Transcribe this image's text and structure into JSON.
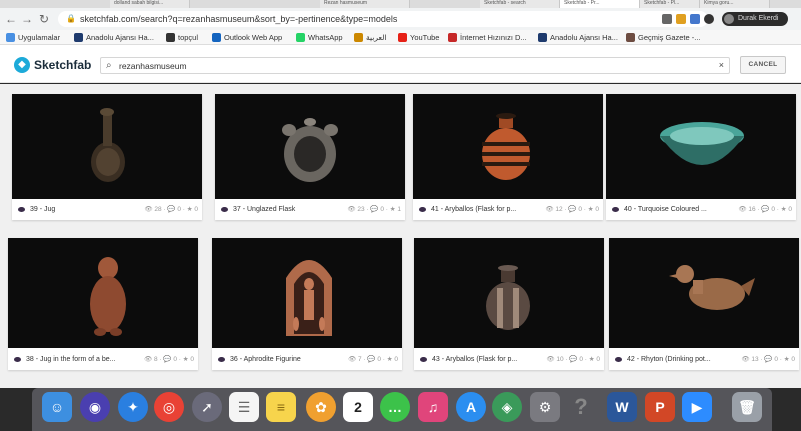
{
  "browser": {
    "tabs": [
      {
        "label": "dolland sabah bilgisi..."
      },
      {
        "label": "Rezan hasmuseum"
      },
      {
        "label": "Sketchfab - search"
      },
      {
        "label": "Sketchfab - Pr..."
      },
      {
        "label": "Sketchfab - Pl..."
      },
      {
        "label": "Kimya goru..."
      }
    ],
    "url": "sketchfab.com/search?q=rezanhasmuseum&sort_by=-pertinence&type=models",
    "profile_name": "Durak Ekerdi"
  },
  "bookmarks": [
    {
      "label": "Uygulamalar",
      "color": "#4a90e2"
    },
    {
      "label": "Anadolu Ajansı Ha...",
      "color": "#1f3b6e"
    },
    {
      "label": "topçul",
      "color": "#333333"
    },
    {
      "label": "Outlook Web App",
      "color": "#1565c0"
    },
    {
      "label": "WhatsApp",
      "color": "#25d366"
    },
    {
      "label": "العربية",
      "color": "#cc8800"
    },
    {
      "label": "YouTube",
      "color": "#e62117"
    },
    {
      "label": "İnternet Hızınızı D...",
      "color": "#c62828"
    },
    {
      "label": "Anadolu Ajansı Ha...",
      "color": "#1f3b6e"
    },
    {
      "label": "Geçmiş Gazete -...",
      "color": "#6d4c41"
    }
  ],
  "site": {
    "logo": "Sketchfab",
    "search_value": "rezanhasmuseum",
    "clear_symbol": "×",
    "cancel_label": "CANCEL"
  },
  "models": [
    {
      "title": "39 - Jug",
      "views": "28",
      "comments": "0",
      "likes": "0"
    },
    {
      "title": "37 - Unglazed Flask",
      "views": "23",
      "comments": "0",
      "likes": "1"
    },
    {
      "title": "41 - Aryballos (Flask for p...",
      "views": "12",
      "comments": "0",
      "likes": "0"
    },
    {
      "title": "40 - Turquoise Coloured ...",
      "views": "16",
      "comments": "0",
      "likes": "0"
    },
    {
      "title": "38 - Jug in the form of a be...",
      "views": "8",
      "comments": "0",
      "likes": "0"
    },
    {
      "title": "36 - Aphrodite Figurine",
      "views": "7",
      "comments": "0",
      "likes": "0"
    },
    {
      "title": "43 - Aryballos (Flask for p...",
      "views": "10",
      "comments": "0",
      "likes": "0"
    },
    {
      "title": "42 - Rhyton (Drinking pot...",
      "views": "13",
      "comments": "0",
      "likes": "0"
    }
  ],
  "dock": [
    {
      "name": "finder-icon",
      "color": "#3d8fe0"
    },
    {
      "name": "siri-icon",
      "color": "#4a3fb0"
    },
    {
      "name": "safari-icon",
      "color": "#2a7fe0"
    },
    {
      "name": "chrome-icon",
      "color": "#e94235"
    },
    {
      "name": "launchpad-icon",
      "color": "#6a6a7a"
    },
    {
      "name": "reminders-icon",
      "color": "#f5f5f5"
    },
    {
      "name": "notes-icon",
      "color": "#f7d44c"
    },
    {
      "name": "photos-icon",
      "color": "#f0a030"
    },
    {
      "name": "calendar-icon",
      "color": "#ffffff",
      "text": "2"
    },
    {
      "name": "messages-icon",
      "color": "#3cc24a"
    },
    {
      "name": "itunes-icon",
      "color": "#e0457b"
    },
    {
      "name": "app-store-icon",
      "color": "#2b8ef0"
    },
    {
      "name": "photo-app-icon",
      "color": "#3a9a5a"
    },
    {
      "name": "system-preferences-icon",
      "color": "#7a7a80"
    },
    {
      "name": "help-icon",
      "color": "#777777"
    },
    {
      "name": "word-icon",
      "color": "#2b579a",
      "text": "W"
    },
    {
      "name": "powerpoint-icon",
      "color": "#d24726",
      "text": "P"
    },
    {
      "name": "zoom-icon",
      "color": "#2d8cff"
    },
    {
      "name": "trash-icon",
      "color": "#9aa0a8"
    }
  ]
}
